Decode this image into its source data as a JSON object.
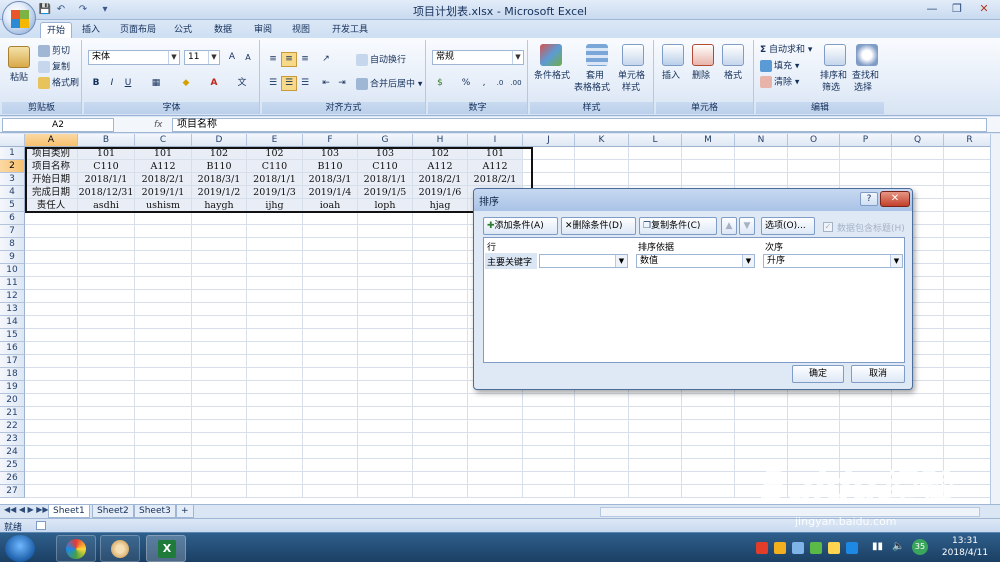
{
  "window": {
    "title": "项目计划表.xlsx - Microsoft Excel"
  },
  "ribbon_tabs": [
    "开始",
    "插入",
    "页面布局",
    "公式",
    "数据",
    "审阅",
    "视图",
    "开发工具"
  ],
  "ribbon": {
    "clipboard": {
      "paste": "粘贴",
      "cut": "剪切",
      "copy": "复制",
      "format_painter": "格式刷",
      "label": "剪贴板"
    },
    "font": {
      "name": "宋体",
      "size": "11",
      "label": "字体"
    },
    "alignment": {
      "wrap": "自动换行",
      "merge": "合并后居中",
      "label": "对齐方式"
    },
    "number": {
      "format": "常规",
      "label": "数字"
    },
    "styles": {
      "cond": "条件格式",
      "table_line1": "套用",
      "table_line2": "表格格式",
      "cell_line1": "单元格",
      "cell_line2": "样式",
      "label": "样式"
    },
    "cells": {
      "insert": "插入",
      "delete": "删除",
      "format": "格式",
      "label": "单元格"
    },
    "editing": {
      "autosum": "自动求和",
      "fill": "填充",
      "clear": "清除",
      "sort_line1": "排序和",
      "sort_line2": "筛选",
      "find_line1": "查找和",
      "find_line2": "选择",
      "label": "编辑"
    }
  },
  "formula_bar": {
    "name_box": "A2",
    "fx": "fx",
    "value": "项目名称"
  },
  "columns": [
    "A",
    "B",
    "C",
    "D",
    "E",
    "F",
    "G",
    "H",
    "I",
    "J",
    "K",
    "L",
    "M",
    "N",
    "O",
    "P",
    "Q",
    "R"
  ],
  "rows": [
    "1",
    "2",
    "3",
    "4",
    "5",
    "6",
    "7",
    "8",
    "9",
    "10",
    "11",
    "12",
    "13",
    "14",
    "15",
    "16",
    "17",
    "18",
    "19",
    "20",
    "21",
    "22",
    "23",
    "24",
    "25",
    "26",
    "27"
  ],
  "cells": [
    [
      "项目类别",
      "101",
      "101",
      "102",
      "102",
      "103",
      "103",
      "102",
      "101"
    ],
    [
      "项目名称",
      "C110",
      "A112",
      "B110",
      "C110",
      "B110",
      "C110",
      "A112",
      "A112"
    ],
    [
      "开始日期",
      "2018/1/1",
      "2018/2/1",
      "2018/3/1",
      "2018/1/1",
      "2018/3/1",
      "2018/1/1",
      "2018/2/1",
      "2018/2/1"
    ],
    [
      "完成日期",
      "2018/12/31",
      "2019/1/1",
      "2019/1/2",
      "2019/1/3",
      "2019/1/4",
      "2019/1/5",
      "2019/1/6",
      ""
    ],
    [
      "责任人",
      "asdhi",
      "ushism",
      "haygh",
      "ijhg",
      "ioah",
      "loph",
      "hjag",
      ""
    ]
  ],
  "sheet_tabs": [
    "Sheet1",
    "Sheet2",
    "Sheet3"
  ],
  "status": {
    "ready": "就绪"
  },
  "taskbar": {
    "time": "13:31",
    "date": "2018/4/11",
    "badge": "35"
  },
  "dialog": {
    "title": "排序",
    "help": "?",
    "close": "✕",
    "add_level": "添加条件(A)",
    "delete_level": "删除条件(D)",
    "copy_level": "复制条件(C)",
    "up": "▲",
    "down": "▼",
    "options": "选项(O)...",
    "header_checkbox": "数据包含标题(H)",
    "col_header": "行",
    "sort_on_header": "排序依据",
    "order_header": "次序",
    "row_label": "主要关键字",
    "key_value": "",
    "sort_on_value": "数值",
    "order_value": "升序",
    "ok": "确定",
    "cancel": "取消"
  },
  "watermark": {
    "brand": "Baidu经验",
    "url": "jingyan.baidu.com"
  }
}
